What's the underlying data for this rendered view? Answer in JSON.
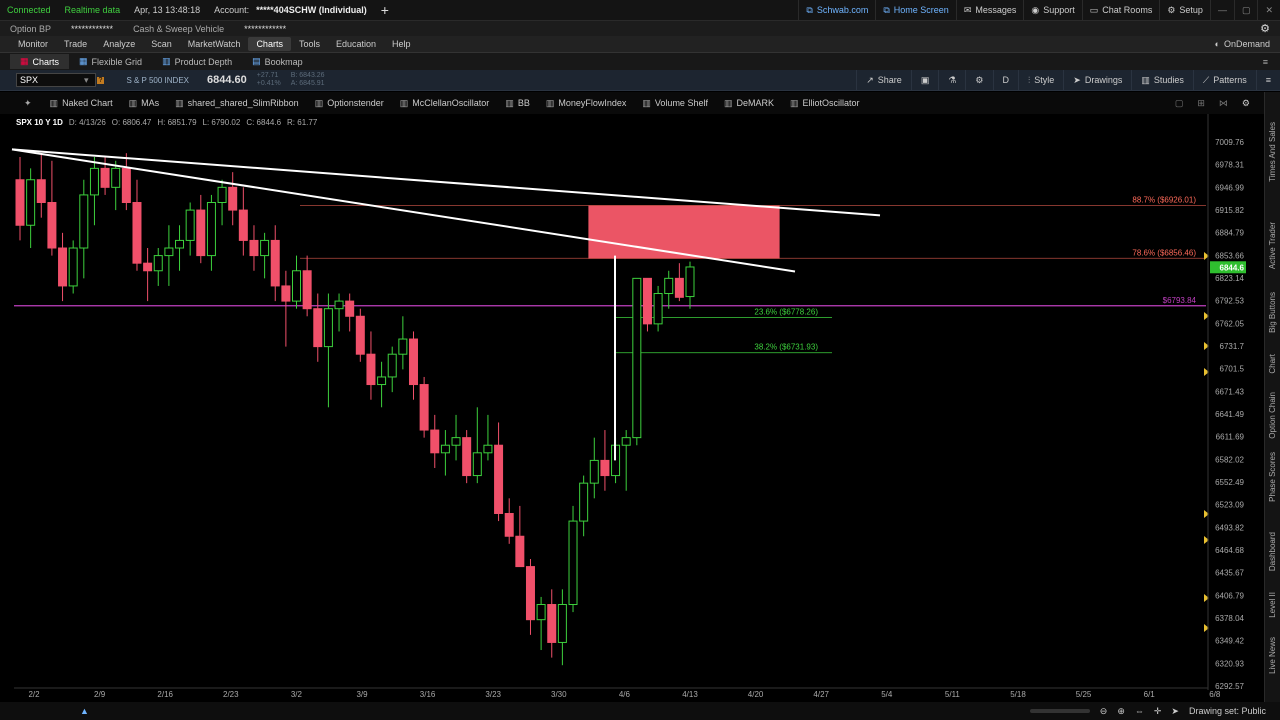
{
  "status": {
    "connected": "Connected",
    "realtime": "Realtime data",
    "datetime": "Apr, 13  13:48:18",
    "account_label": "Account:",
    "account_value": "*****404SCHW (Individual)",
    "schwab": "Schwab.com",
    "home": "Home Screen",
    "messages": "Messages",
    "support": "Support",
    "chatrooms": "Chat Rooms",
    "setup": "Setup"
  },
  "account_bar": {
    "option_bp": "Option BP",
    "option_bp_value": "************",
    "cash_sweep": "Cash & Sweep Vehicle",
    "cash_sweep_value": "************"
  },
  "menu": {
    "items": [
      "Monitor",
      "Trade",
      "Analyze",
      "Scan",
      "MarketWatch",
      "Charts",
      "Tools",
      "Education",
      "Help"
    ],
    "active": "Charts",
    "ondemand": "OnDemand"
  },
  "subtabs": {
    "items": [
      "Charts",
      "Flexible Grid",
      "Product Depth",
      "Bookmap"
    ]
  },
  "symbol": {
    "value": "SPX",
    "description": "S & P 500 INDEX",
    "price": "6844.60",
    "chg1": "+27.71",
    "chg2": "+0.41%",
    "bid": "B: 6843.26",
    "ask": "A: 6845.91",
    "share": "Share",
    "period": "D",
    "style": "Style",
    "drawings": "Drawings",
    "studies": "Studies",
    "patterns": "Patterns"
  },
  "studies_bar": {
    "items": [
      "Naked Chart",
      "MAs",
      "shared_shared_SlimRibbon",
      "Optionstender",
      "McClellanOscillator",
      "BB",
      "MoneyFlowIndex",
      "Volume Shelf",
      "DeMARK",
      "ElliotOscillator"
    ]
  },
  "infoline": {
    "symbol": "SPX 10 Y 1D",
    "date": "D: 4/13/26",
    "open": "O: 6806.47",
    "high": "H: 6851.79",
    "low": "L: 6790.02",
    "close": "C: 6844.6",
    "range": "R: 61.77"
  },
  "side_tabs": [
    "Times And Sales",
    "Active Trader",
    "Big Buttons",
    "Chart",
    "Option Chain",
    "Phase Scores",
    "Dashboard",
    "Level II",
    "Live News"
  ],
  "bottom": {
    "drawing_set": "Drawing set: Public"
  },
  "colors": {
    "up": "#3dd13d",
    "down": "#f0506a",
    "zone": "#ff5c6e",
    "magenta": "#c040c0",
    "fib_red": "#ff6a5a",
    "fib_green": "#3dd13d",
    "trend": "#ffffff",
    "price_tag": "#2fbf2f"
  },
  "chart_data": {
    "type": "candlestick",
    "yticks": [
      "7009.76",
      "6978.31",
      "6946.99",
      "6915.82",
      "6884.79",
      "6853.66",
      "6823.14",
      "6792.53",
      "6762.05",
      "6731.7",
      "6701.5",
      "6671.43",
      "6641.49",
      "6611.69",
      "6582.02",
      "6552.49",
      "6523.09",
      "6493.82",
      "6464.68",
      "6435.67",
      "6406.79",
      "6378.04",
      "6349.42",
      "6320.93",
      "6292.57"
    ],
    "xticks": [
      "2/2",
      "2/9",
      "2/16",
      "2/23",
      "3/2",
      "3/9",
      "3/16",
      "3/23",
      "3/30",
      "4/6",
      "4/13",
      "4/20",
      "4/27",
      "5/4",
      "5/11",
      "5/18",
      "5/25",
      "6/1",
      "6/8"
    ],
    "ylim": [
      6292.57,
      7009.76
    ],
    "last_price": "6844.6",
    "candles": [
      [
        6960,
        6990,
        6880,
        6900
      ],
      [
        6900,
        6975,
        6870,
        6960
      ],
      [
        6960,
        6995,
        6910,
        6930
      ],
      [
        6930,
        6985,
        6860,
        6870
      ],
      [
        6870,
        6890,
        6800,
        6820
      ],
      [
        6820,
        6880,
        6810,
        6870
      ],
      [
        6870,
        6960,
        6830,
        6940
      ],
      [
        6940,
        6990,
        6900,
        6975
      ],
      [
        6975,
        6990,
        6940,
        6950
      ],
      [
        6950,
        6985,
        6920,
        6975
      ],
      [
        6975,
        6995,
        6920,
        6930
      ],
      [
        6930,
        6960,
        6840,
        6850
      ],
      [
        6850,
        6870,
        6800,
        6840
      ],
      [
        6840,
        6870,
        6820,
        6860
      ],
      [
        6860,
        6900,
        6820,
        6870
      ],
      [
        6870,
        6900,
        6840,
        6880
      ],
      [
        6880,
        6930,
        6860,
        6920
      ],
      [
        6920,
        6940,
        6850,
        6860
      ],
      [
        6860,
        6940,
        6840,
        6930
      ],
      [
        6930,
        6960,
        6900,
        6950
      ],
      [
        6950,
        6970,
        6900,
        6920
      ],
      [
        6920,
        6950,
        6860,
        6880
      ],
      [
        6880,
        6900,
        6840,
        6860
      ],
      [
        6860,
        6890,
        6830,
        6880
      ],
      [
        6880,
        6900,
        6800,
        6820
      ],
      [
        6820,
        6840,
        6740,
        6800
      ],
      [
        6800,
        6860,
        6790,
        6840
      ],
      [
        6840,
        6860,
        6780,
        6790
      ],
      [
        6790,
        6810,
        6720,
        6740
      ],
      [
        6740,
        6810,
        6660,
        6790
      ],
      [
        6790,
        6810,
        6760,
        6800
      ],
      [
        6800,
        6810,
        6760,
        6780
      ],
      [
        6780,
        6790,
        6720,
        6730
      ],
      [
        6730,
        6760,
        6670,
        6690
      ],
      [
        6690,
        6720,
        6660,
        6700
      ],
      [
        6700,
        6740,
        6680,
        6730
      ],
      [
        6730,
        6780,
        6710,
        6750
      ],
      [
        6750,
        6760,
        6670,
        6690
      ],
      [
        6690,
        6700,
        6620,
        6630
      ],
      [
        6630,
        6650,
        6580,
        6600
      ],
      [
        6600,
        6630,
        6570,
        6610
      ],
      [
        6610,
        6650,
        6590,
        6620
      ],
      [
        6620,
        6630,
        6560,
        6570
      ],
      [
        6570,
        6660,
        6560,
        6600
      ],
      [
        6600,
        6650,
        6590,
        6610
      ],
      [
        6610,
        6640,
        6510,
        6520
      ],
      [
        6520,
        6540,
        6480,
        6490
      ],
      [
        6490,
        6530,
        6450,
        6450
      ],
      [
        6450,
        6460,
        6360,
        6380
      ],
      [
        6380,
        6410,
        6340,
        6400
      ],
      [
        6400,
        6420,
        6330,
        6350
      ],
      [
        6350,
        6420,
        6320,
        6400
      ],
      [
        6400,
        6530,
        6390,
        6510
      ],
      [
        6510,
        6570,
        6490,
        6560
      ],
      [
        6560,
        6620,
        6540,
        6590
      ],
      [
        6590,
        6630,
        6550,
        6570
      ],
      [
        6570,
        6620,
        6560,
        6610
      ],
      [
        6610,
        6630,
        6550,
        6620
      ],
      [
        6620,
        6830,
        6610,
        6830
      ],
      [
        6830,
        6780,
        6760,
        6770
      ],
      [
        6770,
        6820,
        6760,
        6810
      ],
      [
        6810,
        6840,
        6790,
        6830
      ],
      [
        6830,
        6850,
        6800,
        6805
      ],
      [
        6806,
        6852,
        6790,
        6845
      ]
    ],
    "trendlines": [
      {
        "from": [
          "2/2",
          7000
        ],
        "to": [
          "4/27",
          6850
        ],
        "label": ""
      },
      {
        "from": [
          "2/2",
          7000
        ],
        "to": [
          "4/27",
          6910
        ],
        "label": ""
      }
    ],
    "zone": {
      "x_from": "4/6",
      "x_to": "4/20",
      "y_top": 6926,
      "y_bottom": 6856
    },
    "levels": [
      {
        "label": "88.7% ($6926.01)",
        "value": 6926.01,
        "color": "red"
      },
      {
        "label": "78.6% ($6856.46)",
        "value": 6856.46,
        "color": "red"
      },
      {
        "label": "$6793.84",
        "value": 6793.84,
        "color": "magenta"
      },
      {
        "label": "23.6% ($6778.26)",
        "value": 6778.26,
        "color": "green"
      },
      {
        "label": "38.2% ($6731.93)",
        "value": 6731.93,
        "color": "green"
      }
    ]
  }
}
